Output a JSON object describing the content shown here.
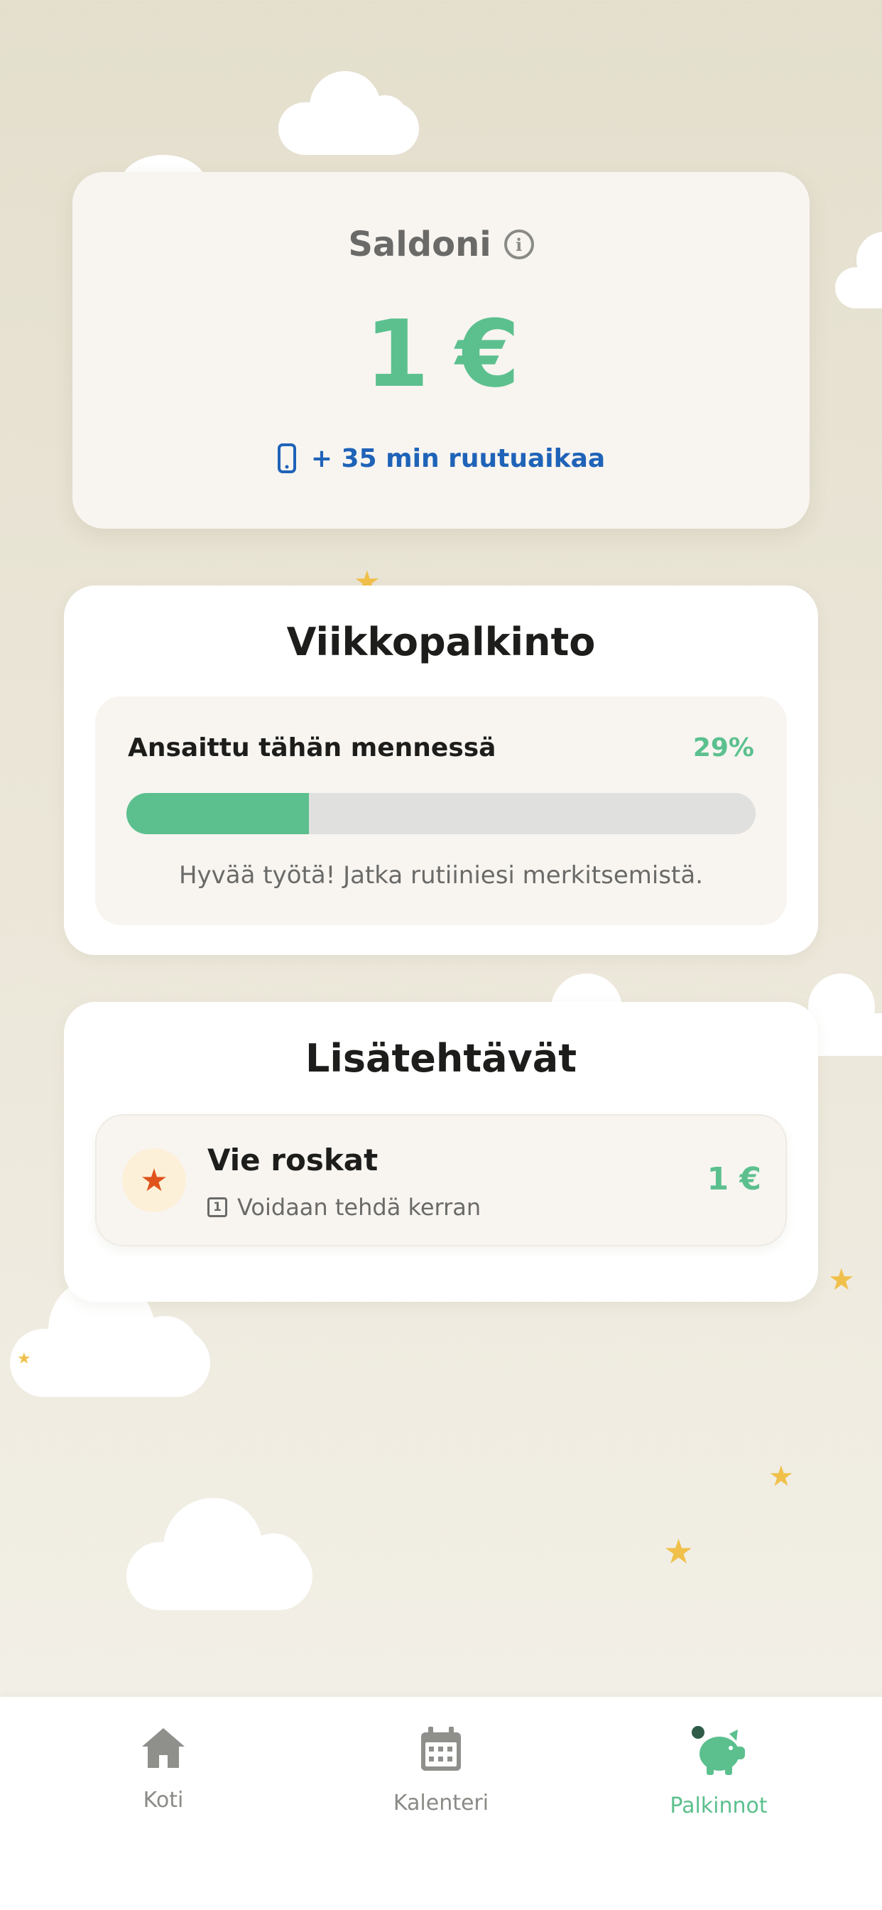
{
  "balance": {
    "title": "Saldoni",
    "amount": "1 €",
    "screen_time": "+ 35 min ruutuaikaa"
  },
  "weekly_reward": {
    "title": "Viikkopalkinto",
    "earned_label": "Ansaittu tähän mennessä",
    "earned_percent": "29%",
    "progress_fraction": 0.29,
    "message": "Hyvää työtä! Jatka rutiiniesi merkitsemistä."
  },
  "extra_tasks": {
    "title": "Lisätehtävät",
    "items": [
      {
        "title": "Vie roskat",
        "frequency_marker": "1",
        "frequency": "Voidaan tehdä kerran",
        "reward": "1 €",
        "icon": "star-icon"
      }
    ]
  },
  "bottom_nav": {
    "items": [
      {
        "label": "Koti",
        "icon": "home-icon",
        "active": false
      },
      {
        "label": "Kalenteri",
        "icon": "calendar-icon",
        "active": false
      },
      {
        "label": "Palkinnot",
        "icon": "piggy-bank-icon",
        "active": true
      }
    ]
  },
  "colors": {
    "accent_green": "#5cc08e",
    "link_blue": "#1f63b8",
    "task_star": "#e0531c",
    "background": "#e4dfcd"
  }
}
